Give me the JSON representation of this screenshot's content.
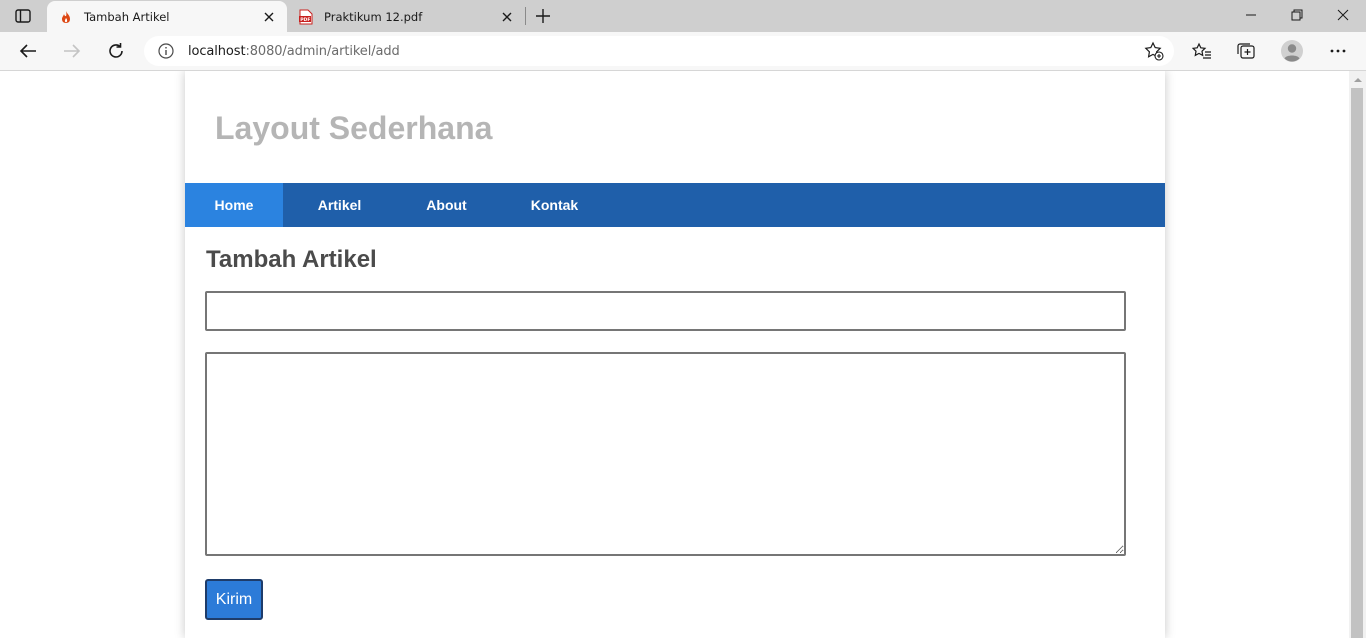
{
  "browser": {
    "tabs": [
      {
        "title": "Tambah Artikel",
        "active": true,
        "favicon": "flame-icon"
      },
      {
        "title": "Praktikum 12.pdf",
        "active": false,
        "favicon": "pdf-icon"
      }
    ],
    "address": {
      "host": "localhost",
      "path": ":8080/admin/artikel/add"
    }
  },
  "site": {
    "title": "Layout Sederhana",
    "nav": [
      {
        "label": "Home",
        "active": true
      },
      {
        "label": "Artikel",
        "active": false
      },
      {
        "label": "About",
        "active": false
      },
      {
        "label": "Kontak",
        "active": false
      }
    ]
  },
  "page": {
    "heading": "Tambah Artikel",
    "form": {
      "title_value": "",
      "content_value": "",
      "submit_label": "Kirim"
    }
  },
  "colors": {
    "nav_bg": "#1f5faa",
    "nav_active_bg": "#2b83e0",
    "button_bg": "#2c7bd8",
    "site_title": "#b5b5b5"
  }
}
